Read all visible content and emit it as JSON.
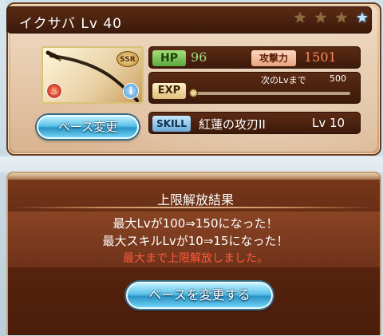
{
  "weapon": {
    "name_level": "イクサバ Lv 40",
    "rarity_badge": "SSR",
    "stars": [
      {
        "icon": "star-icon",
        "state": "filled-bronze"
      },
      {
        "icon": "star-icon",
        "state": "filled-bronze"
      },
      {
        "icon": "star-icon",
        "state": "filled-bronze"
      },
      {
        "icon": "star-icon",
        "state": "filled-blue"
      }
    ],
    "hp_label": "HP",
    "hp_value": "96",
    "atk_label": "攻撃力",
    "atk_value": "1501",
    "exp_label": "EXP",
    "exp_next_label": "次のLvまで",
    "exp_next_value": "500",
    "exp_progress": 0.0,
    "skill_label": "SKILL",
    "skill_name": "紅蓮の攻刃II",
    "skill_level": "Lv 10",
    "element_icon": "fire-element-icon",
    "info_icon": "info-icon",
    "change_base_button": "ベース変更"
  },
  "result": {
    "header": "上限解放結果",
    "line1": "最大Lvが100⇒150になった！",
    "line2": "最大スキルLvが10⇒15になった！",
    "line3": "最大まで上限解放しました。",
    "change_base_button": "ベースを変更する"
  },
  "colors": {
    "frame_brown": "#5a2a14",
    "hp_green": "#9ee07a",
    "atk_orange": "#ff8a5a",
    "notice_red": "#ff5a3a",
    "button_blue": "#5bc2e8"
  }
}
